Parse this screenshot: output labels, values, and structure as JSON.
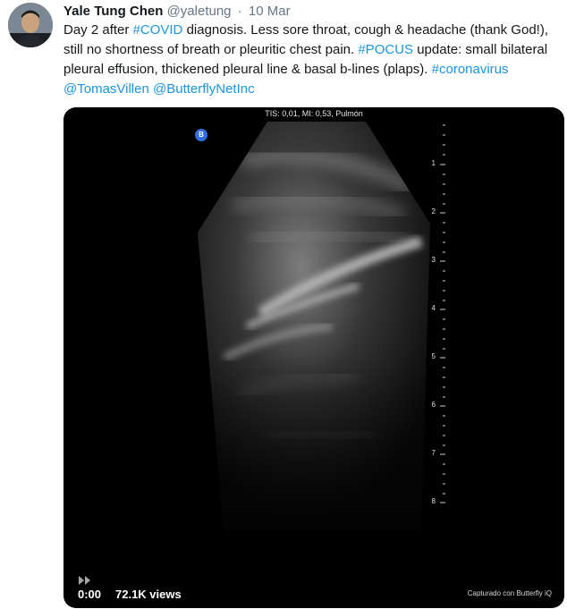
{
  "tweet": {
    "author_name": "Yale Tung Chen",
    "author_handle": "@yaletung",
    "separator": "·",
    "date": "10 Mar",
    "text": {
      "seg1": "Day 2 after ",
      "link_covid": "#COVID",
      "seg2": " diagnosis. Less sore throat, cough & headache (thank God!), still no shortness of breath or pleuritic chest pain. ",
      "link_pocus": "#POCUS",
      "seg3": " update: small bilateral pleural effusion, thickened pleural line & basal b-lines (plaps). ",
      "link_coronavirus": "#coronavirus",
      "seg4": " ",
      "link_tomas": "@TomasVillen",
      "seg5": " ",
      "link_butterfly": "@ButterflyNetInc"
    }
  },
  "video": {
    "scan_header": "TIS: 0,01, MI: 0,53, Pulmón",
    "mode_badge": "B",
    "depth_labels": [
      "1",
      "2",
      "3",
      "4",
      "5",
      "6",
      "7",
      "8"
    ],
    "time": "0:00",
    "views": "72.1K views",
    "capture_text": "Capturado con Butterfly iQ"
  },
  "colors": {
    "link": "#1b95e0",
    "text": "#14171a",
    "muted": "#657786",
    "video_bg": "#000000",
    "badge": "#2f6fe0"
  },
  "icons": {
    "play": "play-icon",
    "avatar": "avatar"
  }
}
